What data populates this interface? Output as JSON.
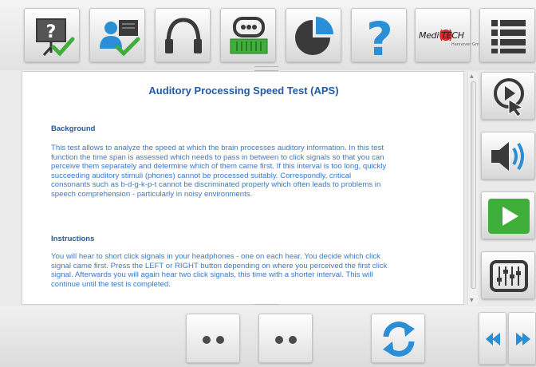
{
  "toolbar": {
    "buttons": [
      {
        "name": "presentation-check-button",
        "icon": "presentation-question-check-icon"
      },
      {
        "name": "user-check-button",
        "icon": "user-card-check-icon"
      },
      {
        "name": "headphones-button",
        "icon": "headphones-icon"
      },
      {
        "name": "hearing-device-button",
        "icon": "hearing-device-icon"
      },
      {
        "name": "pie-chart-button",
        "icon": "pie-chart-icon"
      },
      {
        "name": "help-button",
        "icon": "question-mark-icon"
      },
      {
        "name": "meditech-logo-button",
        "icon": "meditech-logo"
      },
      {
        "name": "menu-button",
        "icon": "list-menu-icon"
      }
    ],
    "logo_text": "Medi TECH",
    "logo_sub": "Hannover GmbH"
  },
  "document": {
    "title": "Auditory Processing Speed Test (APS)",
    "background_heading": "Background",
    "background_lines": [
      "This test allows to analyze the speed at which the brain processes auditory information. In this test",
      "function the time span is assessed which needs to pass in between to click signals so that you can",
      "perceive them separately and determine which of them came first. If this interval is too long, quickly",
      "succeeding auditory stimuli (phones) cannot be processed suitably. Correspondly, critical",
      "consonants such as b-d-g-k-p-t cannot be discriminated properly which often leads to problems in",
      "speech comprehension - particularly in noisy environments."
    ],
    "instructions_heading": "Instructions",
    "instructions_lines": [
      "You will hear to short click signals in your headphones - one on each hear. You decide which click",
      "signal came first. Press the LEFT or RIGHT button depending on where you perceived the first click",
      "signal. Afterwards you will again hear two click signals, this time with a shorter interval. This will",
      "continue until the test is completed."
    ]
  },
  "side": {
    "buttons": [
      {
        "name": "touch-play-button",
        "icon": "touch-play-icon"
      },
      {
        "name": "volume-button",
        "icon": "speaker-icon"
      },
      {
        "name": "start-button",
        "icon": "play-icon"
      },
      {
        "name": "mixer-button",
        "icon": "equalizer-icon"
      }
    ]
  },
  "bottom": {
    "buttons": [
      {
        "name": "left-button",
        "icon": "two-dots-icon"
      },
      {
        "name": "right-button",
        "icon": "two-dots-icon"
      },
      {
        "name": "repeat-button",
        "icon": "refresh-icon"
      },
      {
        "name": "previous-button",
        "icon": "double-arrow-left-icon"
      },
      {
        "name": "next-button",
        "icon": "double-arrow-right-icon"
      }
    ]
  },
  "colors": {
    "accent_blue": "#1f5aa8",
    "text_blue": "#3a78c8",
    "icon_blue": "#2a8fd6",
    "icon_green": "#3fae3a",
    "dark_gray": "#3a3a3a"
  }
}
